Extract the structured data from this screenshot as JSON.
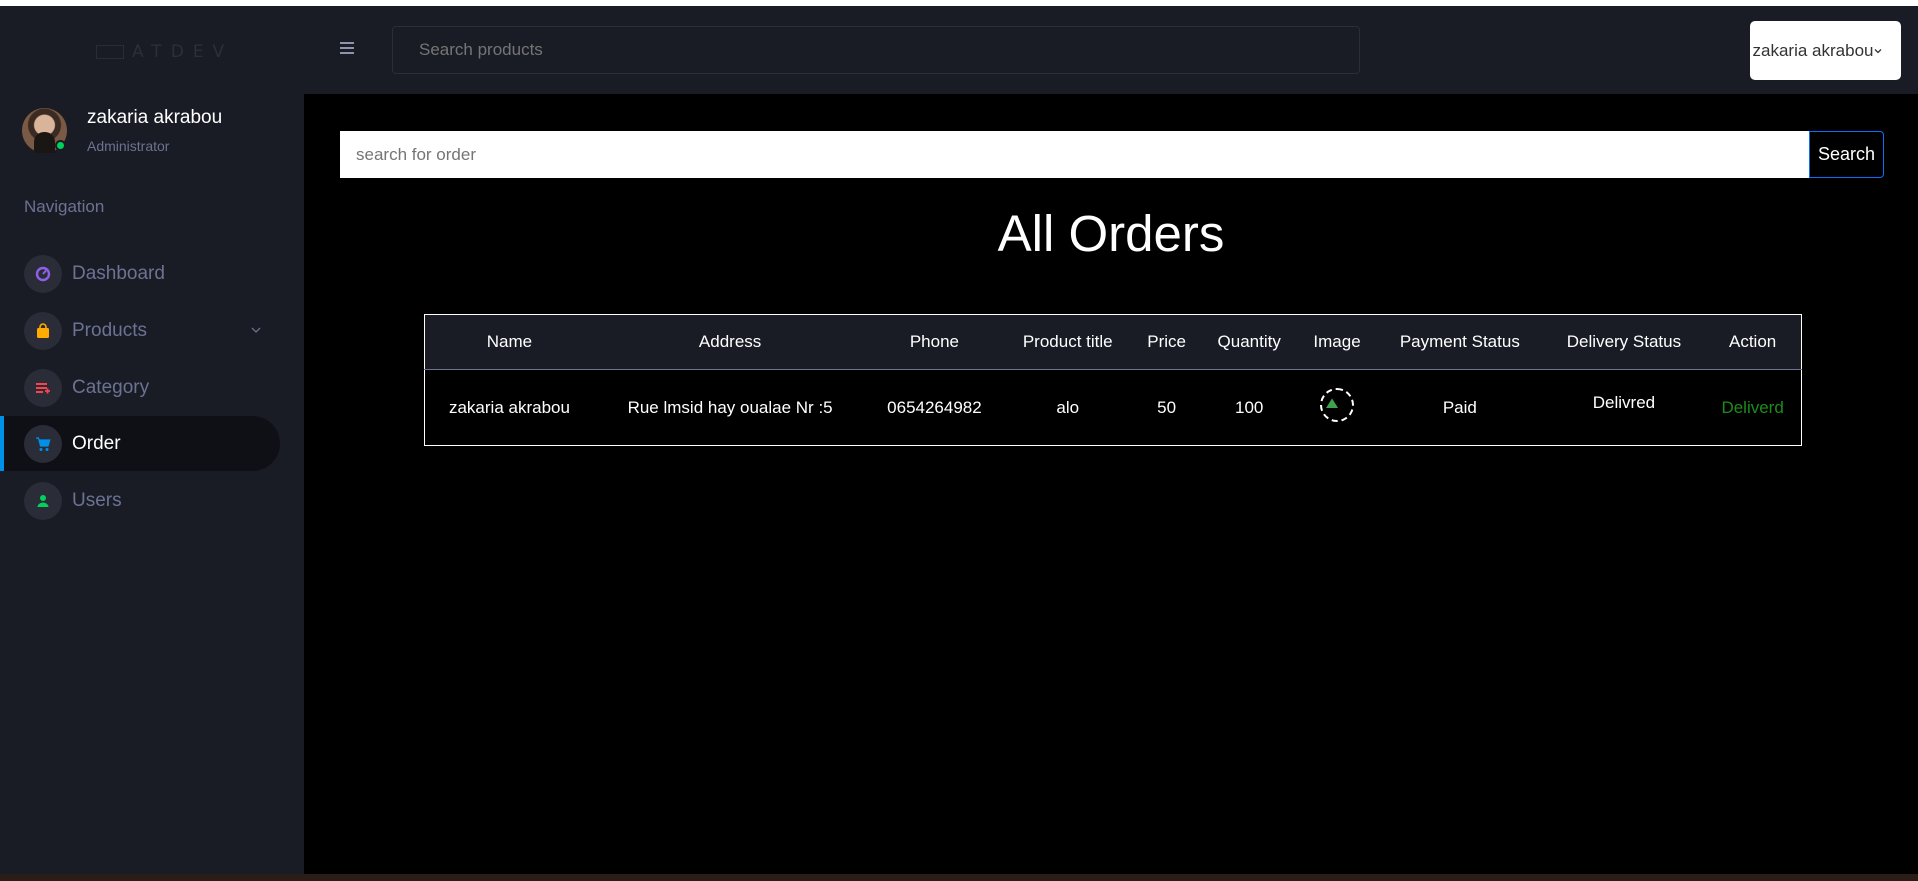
{
  "brand": {
    "logo_text": "ATDEV"
  },
  "profile": {
    "name": "zakaria akrabou",
    "role": "Administrator"
  },
  "sidebar": {
    "title": "Navigation",
    "items": [
      {
        "label": "Dashboard",
        "icon": "speedometer-icon",
        "color": "#8f5fe8"
      },
      {
        "label": "Products",
        "icon": "bag-icon",
        "color": "#ffab00"
      },
      {
        "label": "Category",
        "icon": "list-icon",
        "color": "#fc424a"
      },
      {
        "label": "Order",
        "icon": "cart-icon",
        "color": "#0090e7",
        "active": true
      },
      {
        "label": "Users",
        "icon": "user-icon",
        "color": "#00d25b"
      }
    ]
  },
  "navbar": {
    "search_placeholder": "Search products",
    "user_name": "zakaria akrabou"
  },
  "main": {
    "search_placeholder": "search for order",
    "search_button": "Search",
    "title": "All Orders"
  },
  "table": {
    "headers": [
      "Name",
      "Address",
      "Phone",
      "Product title",
      "Price",
      "Quantity",
      "Image",
      "Payment Status",
      "Delivery Status",
      "Action"
    ],
    "rows": [
      {
        "name": "zakaria akrabou",
        "address": "Rue lmsid hay oualae Nr :5",
        "phone": "0654264982",
        "product_title": "alo",
        "price": "50",
        "quantity": "100",
        "payment_status": "Paid",
        "delivery_status": "Delivred",
        "action": "Deliverd"
      }
    ]
  },
  "colors": {
    "accent": "#0090e7",
    "sidebar_bg": "#191c24",
    "success": "#1c8c1c"
  }
}
